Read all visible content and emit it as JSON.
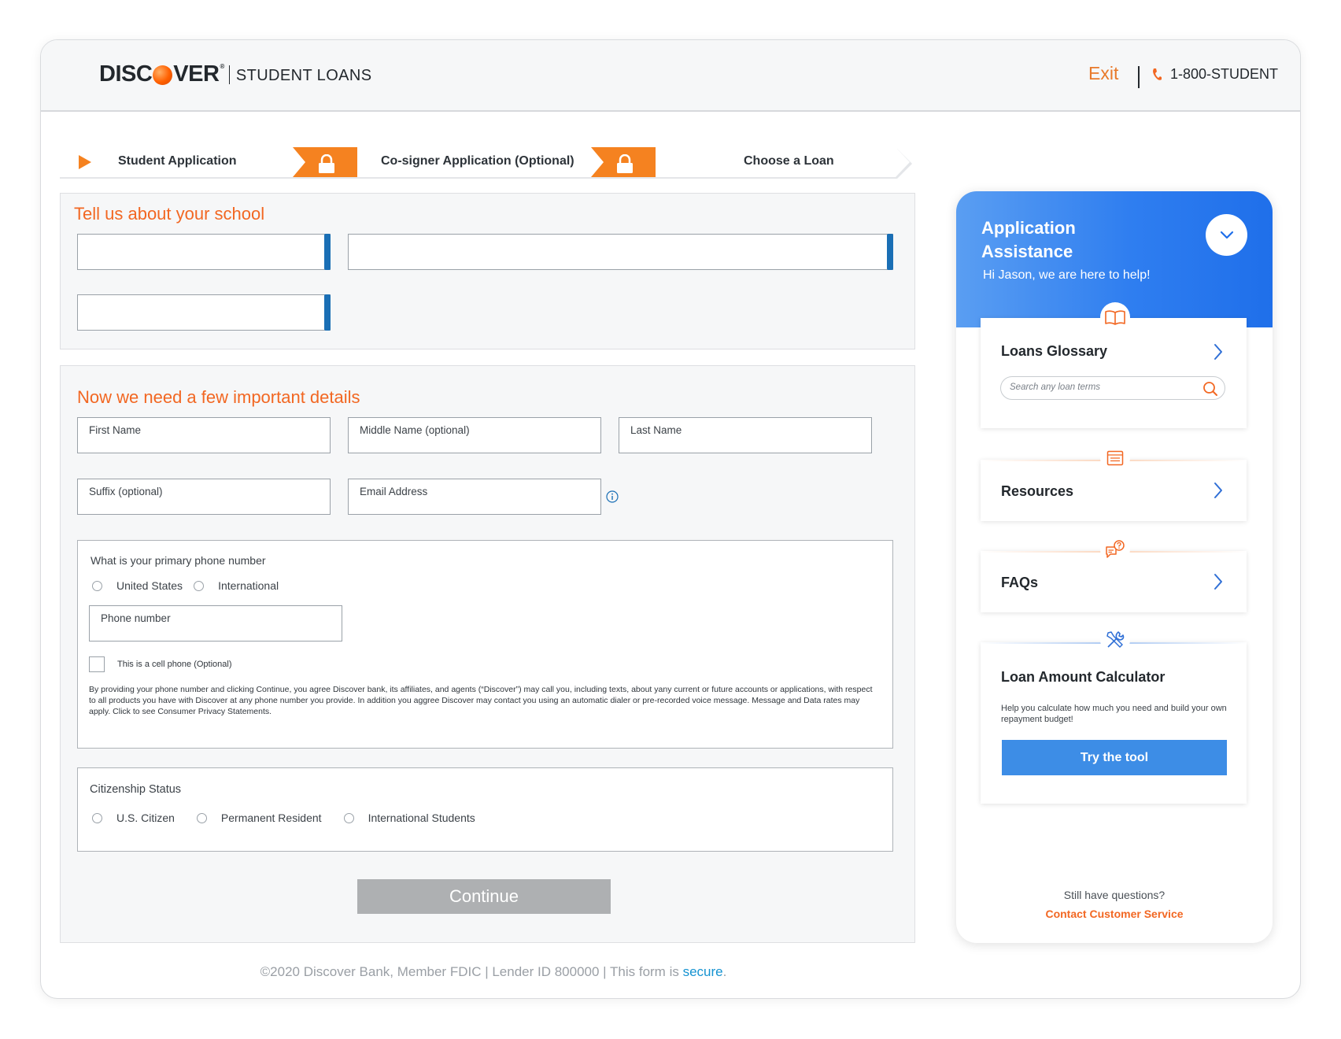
{
  "header": {
    "brand_left": "DISC",
    "brand_right": "VER",
    "brand_sub": "STUDENT LOANS",
    "exit_label": "Exit",
    "phone": "1-800-STUDENT"
  },
  "stepper": {
    "steps": [
      {
        "label": "Student Application"
      },
      {
        "label": "Co-signer Application (Optional)"
      },
      {
        "label": "Choose a Loan"
      }
    ],
    "accent": "#f58220"
  },
  "school_section": {
    "title": "Tell us about your school"
  },
  "details_section": {
    "title": "Now we need a few important details",
    "fields": {
      "first_name": "First Name",
      "middle_name": "Middle Name (optional)",
      "last_name": "Last Name",
      "suffix": "Suffix (optional)",
      "email": "Email Address"
    },
    "phone_box": {
      "question": "What is your primary phone number",
      "options": [
        "United States",
        "International"
      ],
      "phone_label": "Phone number",
      "cell_label": "This is a cell phone (Optional)",
      "disclaimer": "By providing your phone number and clicking Continue, you agree Discover bank, its affiliates, and agents (“Discover”) may call you, including texts, about yany current or future accounts or applications, with respect to all products you have with Discover at any phone number you provide. In addition you aggree Discover may contact you using an automatic dialer or pre-recorded voice message. Message and Data rates may apply. Click to see Consumer Privacy Statements."
    },
    "citizenship": {
      "label": "Citizenship Status",
      "options": [
        "U.S. Citizen",
        "Permanent Resident",
        "International Students"
      ]
    },
    "continue_label": "Continue"
  },
  "footer": {
    "text": "©2020 Discover Bank, Member FDIC | Lender ID 800000 | This form is ",
    "secure": "secure",
    "period": "."
  },
  "assistance": {
    "title": "Application Assistance",
    "greeting": "Hi Jason, we are here to help!",
    "glossary": {
      "title": "Loans Glossary",
      "search_placeholder": "Search any loan terms"
    },
    "resources_title": "Resources",
    "faqs_title": "FAQs",
    "calculator": {
      "title": "Loan Amount Calculator",
      "description": "Help you calculate how much you need and build your own repayment budget!",
      "button": "Try the tool"
    },
    "still_questions": "Still have questions?",
    "contact": "Contact Customer Service",
    "colors": {
      "header_blue": "#2f7ef0",
      "orange": "#f26722"
    }
  }
}
